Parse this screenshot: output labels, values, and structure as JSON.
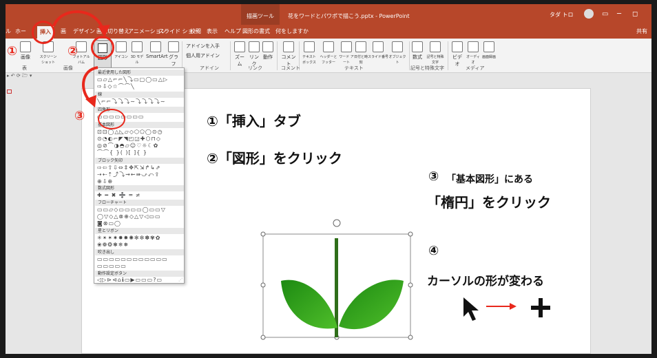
{
  "titlebar": {
    "contextual_tab": "描画ツール",
    "doc_title": "花をワードとパワポで描こう.pptx - PowerPoint",
    "user": "タダ トロ"
  },
  "tabs": [
    "ル",
    "ホー",
    "挿入",
    "画",
    "デザイン",
    "画面切り替え",
    "アニメーション",
    "スライド ショー",
    "校閲",
    "表示",
    "ヘルプ",
    "図形の書式"
  ],
  "tell_me": "何をしますか",
  "share": "共有",
  "ribbon": {
    "buttons": [
      "画像",
      "スクリーンショット",
      "フォトアルバム",
      "図形",
      "アイコン",
      "3D モデル",
      "SmartArt",
      "グラフ",
      "アドインを入手",
      "個人用アドイン",
      "ズーム",
      "リンク",
      "動作",
      "コメント",
      "テキスト ボックス",
      "ヘッダーとフッター",
      "ワード アート",
      "日付と時刻",
      "スライド番号",
      "オブジェクト",
      "数式",
      "記号と特殊文字",
      "ビデオ",
      "オーディオ",
      "画面録画"
    ],
    "groups": [
      "表",
      "画像",
      "アドイン",
      "リンク",
      "コメント",
      "テキスト",
      "記号と特殊文字",
      "メディア"
    ]
  },
  "gallery": {
    "categories": [
      "最近使用した図形",
      "線",
      "四角形",
      "基本図形",
      "ブロック矢印",
      "数式図形",
      "フローチャート",
      "星とリボン",
      "吹き出し",
      "動作設定ボタン"
    ],
    "rows": {
      "recent": "▭▱△⌐⌐╲⤵▭▢◯▭△▷",
      "recent2": "⇨⇩◇☆⌒⌒╲",
      "lines": "╲⌐⌐⤵⤵⤵∼⤵⤵⤵⤵∼",
      "rect": "▭▭▭▭▭▭▭▭",
      "basic1": "⊡⊡◯△◺▱◇⬡⬠◯⊙◷",
      "basic2": "⊙◔◐⌐◤◥◰◲✚⬡⊓◇",
      "basic3": "◎⊘⌒◑◓▱☺♡☼☾✿",
      "basic4": "⌒⌒{ }( )[ ]{ }",
      "block1": "⇨⇦⇧⇩⇔⇕✥⇱⇲↱↳⇗",
      "block2": "⇢⇠⇡⤴⤵⇝⇜⇛⤻⤺⇪",
      "block3": "⊕⇩⊕",
      "math": "✚ ━ ✖ ➗ ═ ≠",
      "flow1": "▭▭▱◇▭▭▭▭◯▭▭▽",
      "flow2": "◯▽◇△⊗⊕◇△▽◁▭▭",
      "flow3": "◙⊗▭◯",
      "stars1": "✳✴✶✷✸✹✺✻✼✽✾✿",
      "stars2": "❀❁❂❃❄❅",
      "callout1": "▭▭▭▭▭▭▭▭▭▭▭▭",
      "callout2": "▭▭▭▭▭",
      "action": "◁▷⊳⊲⌂ℹ▭▶▭▭▭?▭"
    }
  },
  "steps": {
    "s1": "①「挿入」タブ",
    "s2": "②「図形」をクリック",
    "s3a": "③",
    "s3b": "「基本図形」にある",
    "s3c": "「楕円」をクリック",
    "s4a": "④",
    "s4b": "カーソルの形が変わる"
  },
  "markers": {
    "m1": "①",
    "m2": "②",
    "m3": "③"
  },
  "qat": "▸ ↶ ⟳ 🗁 ▾",
  "colors": {
    "accent": "#b7472a",
    "marker_red": "#e8281c",
    "leaf_green": "#2e9d1e",
    "stem_green": "#2f6e1a"
  }
}
